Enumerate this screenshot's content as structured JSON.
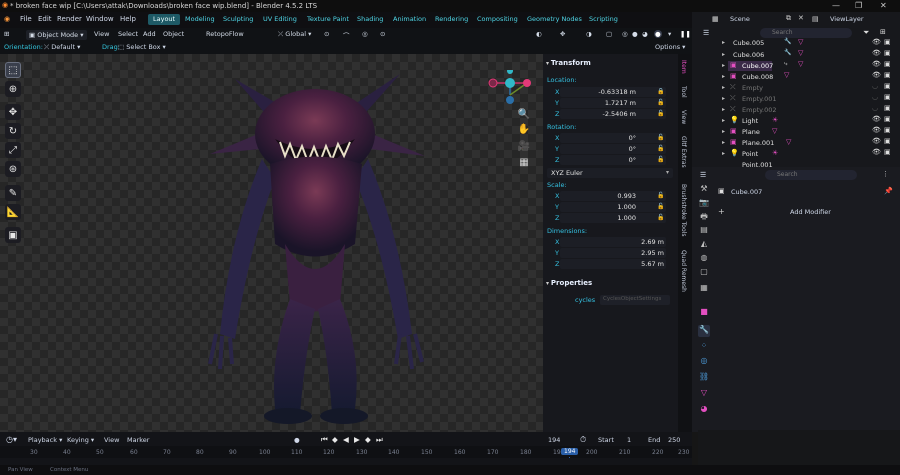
{
  "window": {
    "title": "* broken face wip [C:\\Users\\attak\\Downloads\\broken face wip.blend] - Blender 4.5.2 LTS",
    "min": "—",
    "max": "❐",
    "close": "✕"
  },
  "menu": [
    "File",
    "Edit",
    "Render",
    "Window",
    "Help"
  ],
  "workspaces": [
    "Layout",
    "Modeling",
    "Sculpting",
    "UV Editing",
    "Texture Paint",
    "Shading",
    "Animation",
    "Rendering",
    "Compositing",
    "Geometry Nodes",
    "Scripting"
  ],
  "scene": {
    "scene_label": "Scene",
    "viewlayer_label": "ViewLayer"
  },
  "viewport_header": {
    "mode": "Object Mode",
    "view": "View",
    "select": "Select",
    "add": "Add",
    "object": "Object",
    "retopo": "RetopoFlow",
    "orientation": "Global",
    "options": "Options"
  },
  "tool_options": {
    "orientation_label": "Orientation:",
    "orientation_value": "Default",
    "drag_label": "Drag:",
    "drag_value": "Select Box"
  },
  "transform": {
    "title": "Transform",
    "location_label": "Location:",
    "location": [
      {
        "axis": "X",
        "value": "-0.63318 m"
      },
      {
        "axis": "Y",
        "value": "1.7217 m"
      },
      {
        "axis": "Z",
        "value": "-2.5406 m"
      }
    ],
    "rotation_label": "Rotation:",
    "rotation": [
      {
        "axis": "X",
        "value": "0°"
      },
      {
        "axis": "Y",
        "value": "0°"
      },
      {
        "axis": "Z",
        "value": "0°"
      }
    ],
    "rotation_mode": "XYZ Euler",
    "scale_label": "Scale:",
    "scale": [
      {
        "axis": "X",
        "value": "0.993"
      },
      {
        "axis": "Y",
        "value": "1.000"
      },
      {
        "axis": "Z",
        "value": "1.000"
      }
    ],
    "dimensions_label": "Dimensions:",
    "dimensions": [
      {
        "axis": "X",
        "value": "2.69 m"
      },
      {
        "axis": "Y",
        "value": "2.95 m"
      },
      {
        "axis": "Z",
        "value": "5.67 m"
      }
    ]
  },
  "properties_panel": {
    "title": "Properties",
    "cycles_label": "cycles",
    "cycles_value": "CyclesObjectSettings"
  },
  "npanel_tabs": [
    "Item",
    "Tool",
    "View",
    "Gltf Extras",
    "Brushstroke Tools",
    "Quad Remesh"
  ],
  "outliner": {
    "search_placeholder": "Search",
    "items": [
      {
        "name": "Cube.005",
        "dim": false
      },
      {
        "name": "Cube.006",
        "dim": false
      },
      {
        "name": "Cube.007",
        "dim": false
      },
      {
        "name": "Cube.008",
        "dim": false
      },
      {
        "name": "Empty",
        "dim": true
      },
      {
        "name": "Empty.001",
        "dim": true
      },
      {
        "name": "Empty.002",
        "dim": true
      },
      {
        "name": "Light",
        "dim": false
      },
      {
        "name": "Plane",
        "dim": false
      },
      {
        "name": "Plane.001",
        "dim": false
      },
      {
        "name": "Point",
        "dim": false
      },
      {
        "name": "Point.001",
        "dim": false
      }
    ]
  },
  "properties_editor": {
    "search_placeholder": "Search",
    "object_name": "Cube.007",
    "add_modifier": "Add Modifier"
  },
  "timeline": {
    "playback": "Playback",
    "keying": "Keying",
    "view": "View",
    "marker": "Marker",
    "current_frame": "194",
    "start_label": "Start",
    "start": "1",
    "end_label": "End",
    "end": "250",
    "frames": [
      "30",
      "40",
      "50",
      "60",
      "70",
      "80",
      "90",
      "100",
      "110",
      "120",
      "130",
      "140",
      "150",
      "160",
      "170",
      "180",
      "190",
      "194",
      "200",
      "210",
      "220",
      "230"
    ]
  },
  "status_bar": {
    "left": "Pan View",
    "mid": "Context Menu"
  },
  "colors": {
    "accent_cyan": "#35c8e0",
    "active_object": "#e34fc0",
    "workspace_active": "#1e5a66"
  }
}
